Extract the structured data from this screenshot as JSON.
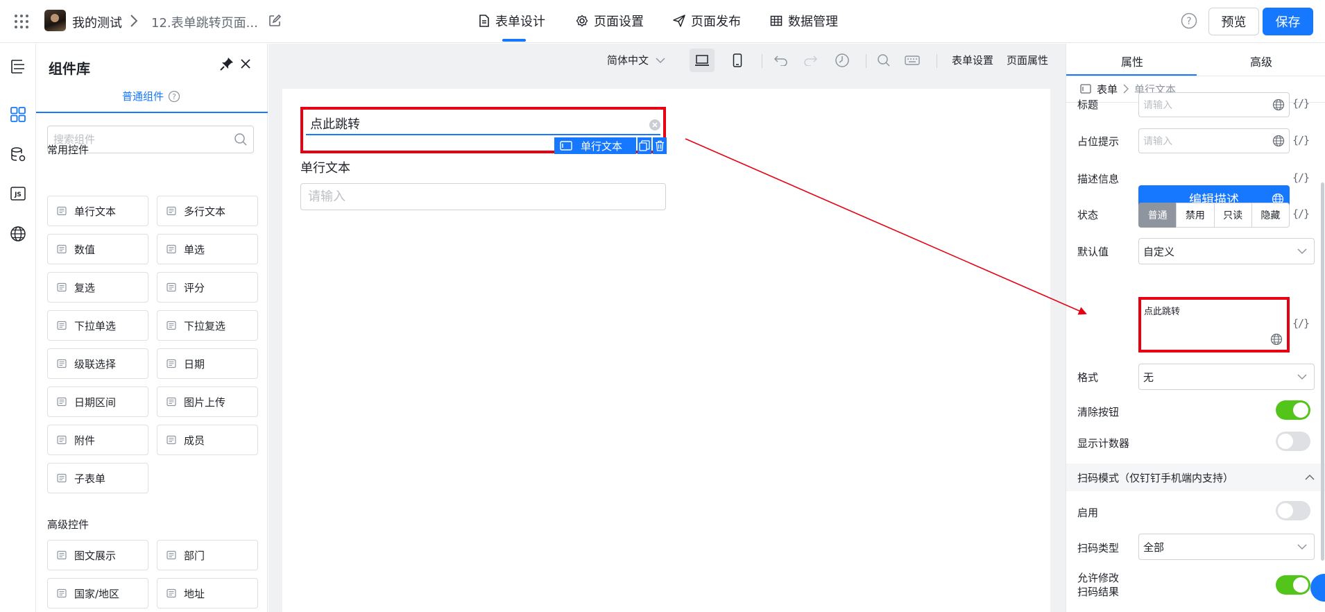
{
  "header": {
    "app_name": "我的测试",
    "page_name": "12.表单跳转页面...",
    "nav": [
      {
        "label": "表单设计",
        "icon": "file-icon"
      },
      {
        "label": "页面设置",
        "icon": "gear-icon"
      },
      {
        "label": "页面发布",
        "icon": "send-icon"
      },
      {
        "label": "数据管理",
        "icon": "table-icon"
      }
    ],
    "preview_label": "预览",
    "save_label": "保存",
    "accent": "#1677ff"
  },
  "library": {
    "title": "组件库",
    "tab": "普通组件",
    "search_placeholder": "搜索组件",
    "common_title": "常用控件",
    "common": [
      "单行文本",
      "多行文本",
      "数值",
      "单选",
      "复选",
      "评分",
      "下拉单选",
      "下拉复选",
      "级联选择",
      "日期",
      "日期区间",
      "图片上传",
      "附件",
      "成员",
      "子表单"
    ],
    "advanced_title": "高级控件",
    "advanced": [
      "图文展示",
      "部门",
      "国家/地区",
      "地址"
    ]
  },
  "toolbar": {
    "language": "简体中文",
    "form_settings": "表单设置",
    "page_props": "页面属性"
  },
  "canvas": {
    "selected_value": "点此跳转",
    "selected_tag": "单行文本",
    "field2_label": "单行文本",
    "field2_placeholder": "请输入"
  },
  "props": {
    "tab_attr": "属性",
    "tab_adv": "高级",
    "crumb_form": "表单",
    "crumb_field": "单行文本",
    "fx": "{/}",
    "title_label": "标题",
    "title_placeholder": "请输入",
    "ph_label": "占位提示",
    "ph_placeholder": "请输入",
    "desc_label": "描述信息",
    "desc_button": "编辑描述",
    "status_label": "状态",
    "status_options": [
      "普通",
      "禁用",
      "只读",
      "隐藏"
    ],
    "status_selected": "普通",
    "default_label": "默认值",
    "default_mode": "自定义",
    "default_value": "点此跳转",
    "format_label": "格式",
    "format_value": "无",
    "clear_label": "清除按钮",
    "clear_on": true,
    "counter_label": "显示计数器",
    "counter_on": false,
    "scan_title": "扫码模式（仅钉钉手机端内支持）",
    "scan_enable_label": "启用",
    "scan_enable_on": false,
    "scan_type_label": "扫码类型",
    "scan_type_value": "全部",
    "allow_edit_line1": "允许修改",
    "allow_edit_line2": "扫码结果",
    "allow_edit_on": true
  },
  "annotation_color": "#e60012"
}
